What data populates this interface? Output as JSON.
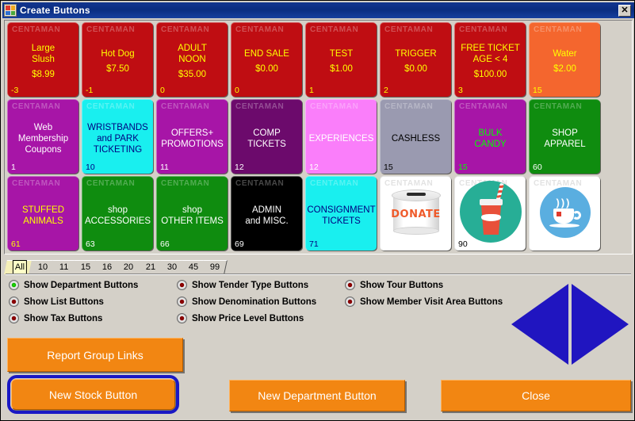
{
  "window": {
    "title": "Create Buttons",
    "icon": "four-color-squares-icon",
    "close_label": "✕"
  },
  "grid": {
    "watermark": "CENTAMAN",
    "buttons": [
      {
        "caption": "Large\nSlush",
        "price": "$8.99",
        "code": "-3",
        "bg": "#bf0d12",
        "text": "#ffff00",
        "code_color": "#ffff00",
        "type": "text"
      },
      {
        "caption": "Hot Dog",
        "price": "$7.50",
        "code": "-1",
        "bg": "#bf0d12",
        "text": "#ffff00",
        "code_color": "#ffff00",
        "type": "text"
      },
      {
        "caption": "ADULT\nNOON",
        "price": "$35.00",
        "code": "0",
        "bg": "#bf0d12",
        "text": "#ffff00",
        "code_color": "#ffff00",
        "type": "text"
      },
      {
        "caption": "END SALE",
        "price": "$0.00",
        "code": "0",
        "bg": "#bf0d12",
        "text": "#ffff00",
        "code_color": "#ffff00",
        "type": "text"
      },
      {
        "caption": "TEST",
        "price": "$1.00",
        "code": "1",
        "bg": "#bf0d12",
        "text": "#ffff00",
        "code_color": "#ffff00",
        "type": "text"
      },
      {
        "caption": "TRIGGER",
        "price": "$0.00",
        "code": "2",
        "bg": "#bf0d12",
        "text": "#ffff00",
        "code_color": "#ffff00",
        "type": "text"
      },
      {
        "caption": "FREE TICKET\nAGE < 4",
        "price": "$100.00",
        "code": "3",
        "bg": "#bf0d12",
        "text": "#ffff00",
        "code_color": "#ffff00",
        "type": "text"
      },
      {
        "caption": "Water",
        "price": "$2.00",
        "code": "15",
        "bg": "#f4662e",
        "text": "#ffff00",
        "code_color": "#ffff00",
        "type": "text"
      },
      {
        "caption": "Web Membership\nCoupons",
        "price": "",
        "code": "1",
        "bg": "#a715a7",
        "text": "#ffffff",
        "code_color": "#ffffff",
        "type": "text"
      },
      {
        "caption": "WRISTBANDS\nand PARK\nTICKETING",
        "price": "",
        "code": "10",
        "bg": "#19efef",
        "text": "#000080",
        "code_color": "#000080",
        "type": "text"
      },
      {
        "caption": "OFFERS+\nPROMOTIONS",
        "price": "",
        "code": "11",
        "bg": "#a715a7",
        "text": "#ffffff",
        "code_color": "#ffffff",
        "type": "text"
      },
      {
        "caption": "COMP TICKETS",
        "price": "",
        "code": "12",
        "bg": "#6c0a6c",
        "text": "#ffffff",
        "code_color": "#ffffff",
        "type": "text"
      },
      {
        "caption": "EXPERIENCES",
        "price": "",
        "code": "12",
        "bg": "#fa7efa",
        "text": "#ffffff",
        "code_color": "#ffffff",
        "type": "text"
      },
      {
        "caption": "CASHLESS",
        "price": "",
        "code": "15",
        "bg": "#9a9ab0",
        "text": "#000000",
        "code_color": "#000000",
        "type": "text"
      },
      {
        "caption": "BULK\nCANDY",
        "price": "",
        "code": "15",
        "bg": "#a715a7",
        "text": "#00ff00",
        "code_color": "#00ff00",
        "type": "text"
      },
      {
        "caption": "SHOP\nAPPAREL",
        "price": "",
        "code": "60",
        "bg": "#0f8c0f",
        "text": "#ffffff",
        "code_color": "#ffffff",
        "type": "text"
      },
      {
        "caption": "STUFFED\nANIMALS",
        "price": "",
        "code": "61",
        "bg": "#a715a7",
        "text": "#ffff00",
        "code_color": "#ffff00",
        "type": "text"
      },
      {
        "caption": "shop\nACCESSORIES",
        "price": "",
        "code": "63",
        "bg": "#0f8c0f",
        "text": "#ffffff",
        "code_color": "#ffffff",
        "type": "text"
      },
      {
        "caption": "shop\nOTHER ITEMS",
        "price": "",
        "code": "66",
        "bg": "#0f8c0f",
        "text": "#ffffff",
        "code_color": "#ffffff",
        "type": "text"
      },
      {
        "caption": "ADMIN\nand MISC.",
        "price": "",
        "code": "69",
        "bg": "#000000",
        "text": "#ffffff",
        "code_color": "#ffffff",
        "type": "text"
      },
      {
        "caption": "CONSIGNMENT\nTICKETS",
        "price": "",
        "code": "71",
        "bg": "#19efef",
        "text": "#000080",
        "code_color": "#000080",
        "type": "text"
      },
      {
        "caption": "",
        "price": "",
        "code": "",
        "bg": "#ffffff",
        "text": "#000000",
        "code_color": "#000000",
        "type": "image",
        "image": "donate-can-icon",
        "image_text": "DONATE"
      },
      {
        "caption": "",
        "price": "",
        "code": "90",
        "bg": "#ffffff",
        "text": "#000000",
        "code_color": "#000000",
        "type": "image",
        "image": "soda-cup-icon"
      },
      {
        "caption": "",
        "price": "",
        "code": "",
        "bg": "#ffffff",
        "text": "#000000",
        "code_color": "#000000",
        "type": "image",
        "image": "tea-cup-icon"
      }
    ]
  },
  "tabs": {
    "active_index": 0,
    "items": [
      "All",
      "10",
      "11",
      "15",
      "16",
      "20",
      "21",
      "30",
      "45",
      "99"
    ]
  },
  "options": [
    {
      "label": "Show Department Buttons",
      "state": "on",
      "col": 0,
      "row": 0
    },
    {
      "label": "Show List Buttons",
      "state": "off",
      "col": 0,
      "row": 1
    },
    {
      "label": "Show Tax Buttons",
      "state": "off",
      "col": 0,
      "row": 2
    },
    {
      "label": "Show Tender Type Buttons",
      "state": "off",
      "col": 1,
      "row": 0
    },
    {
      "label": "Show Denomination Buttons",
      "state": "off",
      "col": 1,
      "row": 1
    },
    {
      "label": "Show Price Level Buttons",
      "state": "off",
      "col": 1,
      "row": 2
    },
    {
      "label": "Show Tour Buttons",
      "state": "off",
      "col": 2,
      "row": 0
    },
    {
      "label": "Show Member Visit Area Buttons",
      "state": "off",
      "col": 2,
      "row": 1
    }
  ],
  "actions": {
    "report_group_links": "Report Group Links",
    "new_stock_button": "New Stock Button",
    "new_department_button": "New Department Button",
    "close": "Close"
  },
  "logo": {
    "name": "blue-diamond-logo",
    "color": "#2015c0"
  },
  "colors": {
    "window_bg": "#d4d0c8",
    "titlebar": "#0a2d80",
    "accent_orange": "#f28612",
    "focus_blue": "#1a18c4"
  }
}
